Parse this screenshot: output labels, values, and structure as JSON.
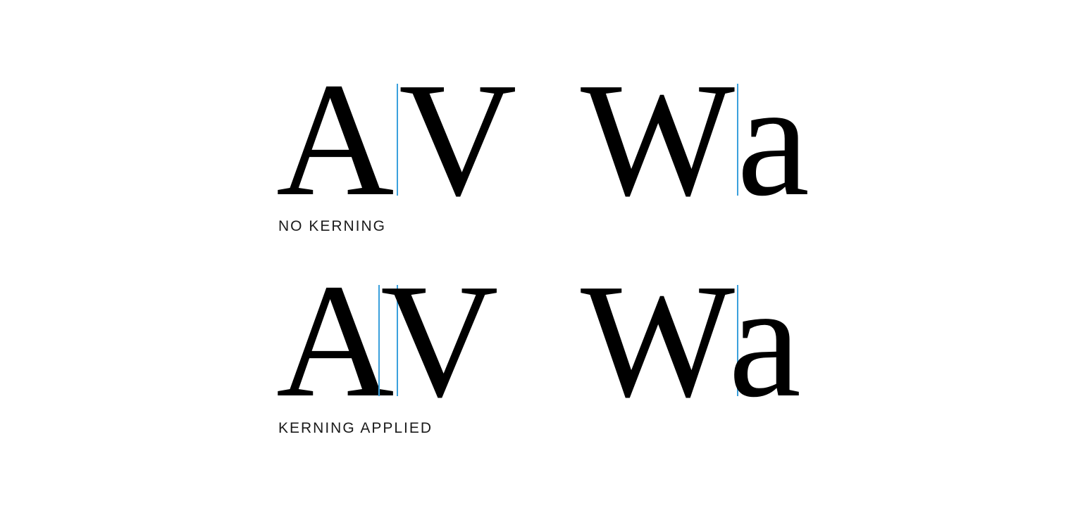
{
  "row1": {
    "pair1": {
      "left": "A",
      "right": "V"
    },
    "pair2": {
      "left": "W",
      "right": "a"
    },
    "caption": "NO KERNING"
  },
  "row2": {
    "pair1": {
      "left": "A",
      "right": "V"
    },
    "pair2": {
      "left": "W",
      "right": "a"
    },
    "caption": "KERNING APPLIED"
  },
  "colors": {
    "guide": "#3aa0dc",
    "text": "#000000"
  }
}
